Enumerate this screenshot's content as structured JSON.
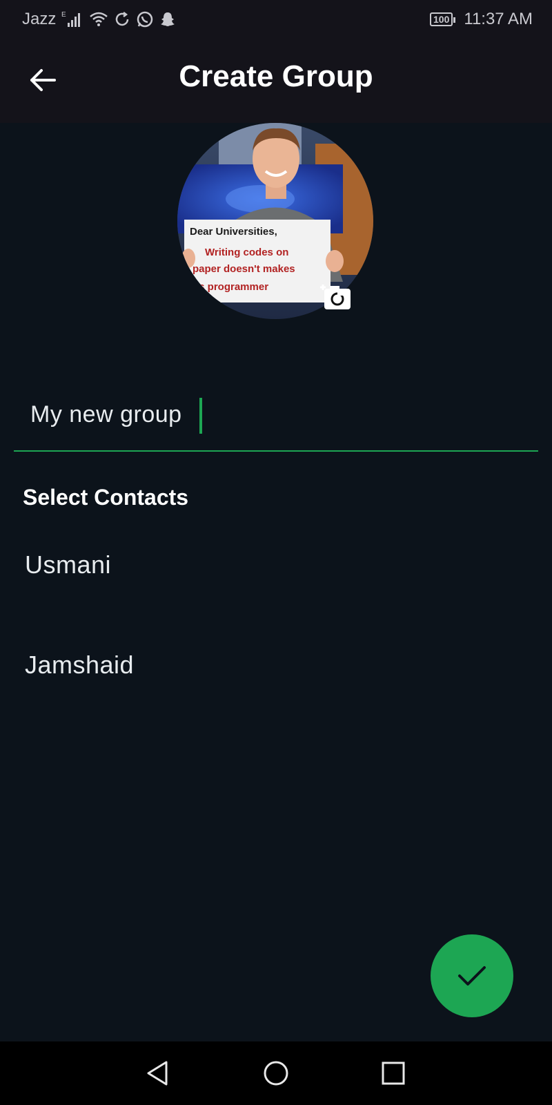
{
  "status_bar": {
    "carrier": "Jazz",
    "network_type": "E",
    "battery": "100",
    "time": "11:37 AM",
    "icons": [
      "signal-icon",
      "wifi-icon",
      "sync-icon",
      "whatsapp-icon",
      "snapchat-icon"
    ]
  },
  "app_bar": {
    "title": "Create Group",
    "back_icon": "arrow-left-icon"
  },
  "group_photo": {
    "sign_line1": "Dear Universities,",
    "sign_line2": "Writing codes on",
    "sign_line3": "paper doesn't makes",
    "sign_line4": "us programmer",
    "add_photo_icon": "add-photo-icon"
  },
  "group_name": {
    "value": "My new group",
    "accent_color": "#1da653"
  },
  "contacts": {
    "title": "Select Contacts",
    "items": [
      {
        "name": "Usmani"
      },
      {
        "name": "Jamshaid"
      }
    ]
  },
  "fab": {
    "icon": "check-icon",
    "color": "#1da653"
  },
  "nav_bar": {
    "icons": [
      "back-triangle-icon",
      "home-circle-icon",
      "recents-square-icon"
    ]
  }
}
